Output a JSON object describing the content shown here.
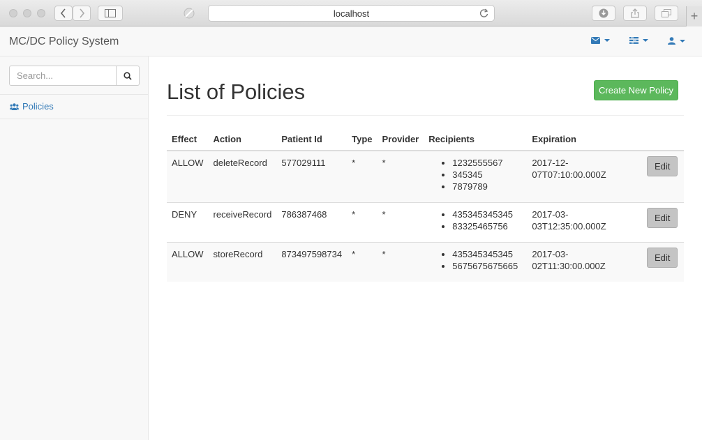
{
  "browser": {
    "url": "localhost"
  },
  "navbar": {
    "brand": "MC/DC Policy System"
  },
  "sidebar": {
    "search_placeholder": "Search...",
    "items": [
      {
        "label": "Policies",
        "icon": "users-icon"
      }
    ]
  },
  "main": {
    "title": "List of Policies",
    "create_button": "Create New Policy",
    "columns": [
      "Effect",
      "Action",
      "Patient Id",
      "Type",
      "Provider",
      "Recipients",
      "Expiration"
    ],
    "rows": [
      {
        "effect": "ALLOW",
        "action": "deleteRecord",
        "patient_id": "577029111",
        "type": "*",
        "provider": "*",
        "recipients": [
          "1232555567",
          "345345",
          "7879789"
        ],
        "expiration": "2017-12-07T07:10:00.000Z",
        "edit_label": "Edit"
      },
      {
        "effect": "DENY",
        "action": "receiveRecord",
        "patient_id": "786387468",
        "type": "*",
        "provider": "*",
        "recipients": [
          "435345345345",
          "83325465756"
        ],
        "expiration": "2017-03-03T12:35:00.000Z",
        "edit_label": "Edit"
      },
      {
        "effect": "ALLOW",
        "action": "storeRecord",
        "patient_id": "873497598734",
        "type": "*",
        "provider": "*",
        "recipients": [
          "435345345345",
          "5675675675665"
        ],
        "expiration": "2017-03-02T11:30:00.000Z",
        "edit_label": "Edit"
      }
    ]
  },
  "colors": {
    "link": "#337ab7",
    "success": "#5cb85c",
    "edit_button": "#c4c4c4"
  }
}
